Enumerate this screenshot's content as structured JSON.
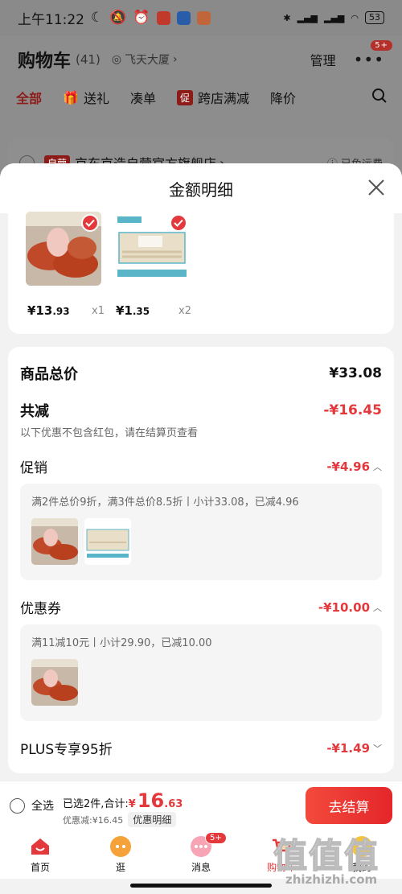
{
  "status_bar": {
    "time": "上午11:22",
    "battery": "53"
  },
  "cart": {
    "title": "购物车",
    "count": "(41)",
    "location": "飞天大厦",
    "manage": "管理",
    "more_badge": "5+",
    "tabs": [
      "全部",
      "送礼",
      "凑单",
      "跨店满减",
      "降价"
    ],
    "promo_badge": "促",
    "store_badge": "自营",
    "store_name": "京东京造自营官方旗舰店",
    "free_shipping": "已免运费"
  },
  "sheet": {
    "title": "金额明细",
    "products": [
      {
        "price_int": "¥13",
        "price_dec": ".93",
        "qty": "x1"
      },
      {
        "price_int": "¥1",
        "price_dec": ".35",
        "qty": "x2"
      }
    ],
    "total_label": "商品总价",
    "total_value": "¥33.08",
    "discount_label": "共减",
    "discount_value": "-¥16.45",
    "discount_note": "以下优惠不包含红包，请在结算页查看",
    "promo_label": "促销",
    "promo_value": "-¥4.96",
    "promo_desc": "满2件总价9折，满3件总价8.5折丨小计33.08，已减4.96",
    "coupon_label": "优惠券",
    "coupon_value": "-¥10.00",
    "coupon_desc": "满11减10元丨小计29.90，已减10.00",
    "plus_label": "PLUS专享95折",
    "plus_value": "-¥1.49"
  },
  "checkout": {
    "select_all": "全选",
    "selected_text": "已选2件,合计:",
    "currency": "¥",
    "total_int": "16",
    "total_dec": ".63",
    "saved": "优惠减:¥16.45",
    "detail_btn": "优惠明细",
    "checkout_btn": "去结算"
  },
  "tabbar": {
    "items": [
      "首页",
      "逛",
      "消息",
      "购物车",
      "我的"
    ],
    "msg_badge": "5+"
  },
  "watermark": {
    "text": "值值值",
    "url": "zhizhizhi.com"
  },
  "colors": {
    "accent": "#e4393c",
    "dim_bg": "#8d8d8d"
  }
}
